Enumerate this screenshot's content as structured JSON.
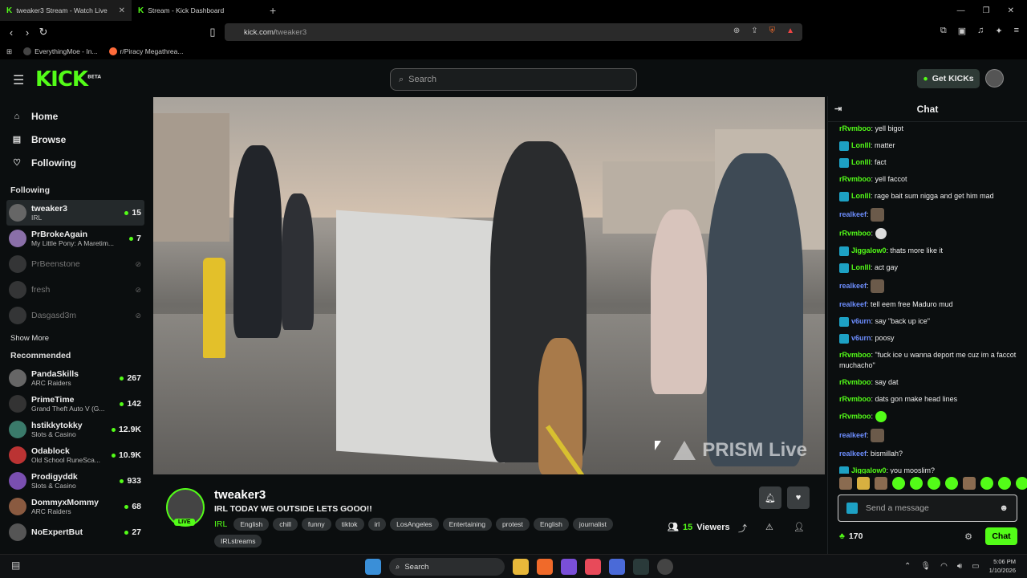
{
  "browser": {
    "tabs": [
      {
        "title": "tweaker3 Stream - Watch Live",
        "active": true
      },
      {
        "title": "Stream - Kick Dashboard",
        "active": false
      }
    ],
    "url_host": "kick.com/",
    "url_path": "tweaker3",
    "bookmarks": [
      "EverythingMoe - In...",
      "r/Piracy Megathrea..."
    ]
  },
  "header": {
    "logo": "KICK",
    "logo_beta": "BETA",
    "search_placeholder": "Search",
    "get_kicks": "Get KICKs"
  },
  "sidebar": {
    "nav": [
      {
        "label": "Home",
        "icon": "home-icon"
      },
      {
        "label": "Browse",
        "icon": "browse-icon"
      },
      {
        "label": "Following",
        "icon": "heart-icon"
      }
    ],
    "following_title": "Following",
    "following": [
      {
        "name": "tweaker3",
        "category": "IRL",
        "viewers": "15",
        "live": true
      },
      {
        "name": "PrBrokeAgain",
        "category": "My Little Pony: A Maretim...",
        "viewers": "7",
        "live": true
      },
      {
        "name": "PrBeenstone",
        "category": "",
        "viewers": "",
        "live": false
      },
      {
        "name": "fresh",
        "category": "",
        "viewers": "",
        "live": false
      },
      {
        "name": "Dasgasd3m",
        "category": "",
        "viewers": "",
        "live": false
      }
    ],
    "show_more": "Show More",
    "recommended_title": "Recommended",
    "recommended": [
      {
        "name": "PandaSkills",
        "category": "ARC Raiders",
        "viewers": "267"
      },
      {
        "name": "PrimeTime",
        "category": "Grand Theft Auto V (G...",
        "viewers": "142"
      },
      {
        "name": "hstikkytokky",
        "category": "Slots & Casino",
        "viewers": "12.9K"
      },
      {
        "name": "Odablock",
        "category": "Old School RuneSca...",
        "viewers": "10.9K"
      },
      {
        "name": "Prodigyddk",
        "category": "Slots & Casino",
        "viewers": "933"
      },
      {
        "name": "DommyxMommy",
        "category": "ARC Raiders",
        "viewers": "68"
      },
      {
        "name": "NoExpertBut",
        "category": "",
        "viewers": "27"
      }
    ]
  },
  "video": {
    "watermark": "PRISM Live"
  },
  "stream": {
    "channel": "tweaker3",
    "live_badge": "LIVE",
    "title": "IRL TODAY WE OUTSIDE LETS GOOO!!",
    "category": "IRL",
    "tags": [
      "English",
      "chill",
      "funny",
      "tiktok",
      "irl",
      "LosAngeles",
      "Entertaining",
      "protest",
      "English",
      "journalist",
      "IRLstreams"
    ],
    "viewers": "15",
    "viewers_label": "Viewers"
  },
  "chat": {
    "title": "Chat",
    "messages": [
      {
        "user": "rRvmboo",
        "color": "#53fc18",
        "text": "yell bigot",
        "badge": false
      },
      {
        "user": "Lonlll",
        "color": "#53fc18",
        "text": "matter",
        "badge": true
      },
      {
        "user": "Lonlll",
        "color": "#53fc18",
        "text": "fact",
        "badge": true
      },
      {
        "user": "rRvmboo",
        "color": "#53fc18",
        "text": "yell faccot",
        "badge": false
      },
      {
        "user": "Lonlll",
        "color": "#53fc18",
        "text": "rage bait sum nigga and get him mad",
        "badge": true
      },
      {
        "user": "realkeef",
        "color": "#6d8eff",
        "text": "",
        "badge": false,
        "emote": "face"
      },
      {
        "user": "rRvmboo",
        "color": "#53fc18",
        "text": "",
        "badge": false,
        "emote": "skull"
      },
      {
        "user": "Jiggalow0",
        "color": "#53fc18",
        "text": "thats more like it",
        "badge": true
      },
      {
        "user": "Lonlll",
        "color": "#53fc18",
        "text": "act gay",
        "badge": true
      },
      {
        "user": "realkeef",
        "color": "#6d8eff",
        "text": "",
        "badge": false,
        "emote": "face"
      },
      {
        "user": "realkeef",
        "color": "#6d8eff",
        "text": "tell eem free Maduro mud",
        "badge": false
      },
      {
        "user": "v6urn",
        "color": "#6d8eff",
        "text": "say \"back up ice\"",
        "badge": true
      },
      {
        "user": "v6urn",
        "color": "#6d8eff",
        "text": "poosy",
        "badge": true
      },
      {
        "user": "rRvmboo",
        "color": "#53fc18",
        "text": "\"fuck ice u wanna deport me cuz im a faccot muchacho\"",
        "badge": false
      },
      {
        "user": "rRvmboo",
        "color": "#53fc18",
        "text": "say dat",
        "badge": false
      },
      {
        "user": "rRvmboo",
        "color": "#53fc18",
        "text": "dats gon make head lines",
        "badge": false
      },
      {
        "user": "rRvmboo",
        "color": "#53fc18",
        "text": "",
        "badge": false,
        "emote": "green"
      },
      {
        "user": "realkeef",
        "color": "#6d8eff",
        "text": "",
        "badge": false,
        "emote": "face"
      },
      {
        "user": "realkeef",
        "color": "#6d8eff",
        "text": "bismillah?",
        "badge": false
      },
      {
        "user": "Jiggalow0",
        "color": "#53fc18",
        "text": "you mooslim?",
        "badge": true
      }
    ],
    "input_placeholder": "Send a message",
    "points": "170",
    "send_label": "Chat"
  },
  "taskbar": {
    "search": "Search",
    "time": "5:06 PM",
    "date": "1/10/2026"
  }
}
